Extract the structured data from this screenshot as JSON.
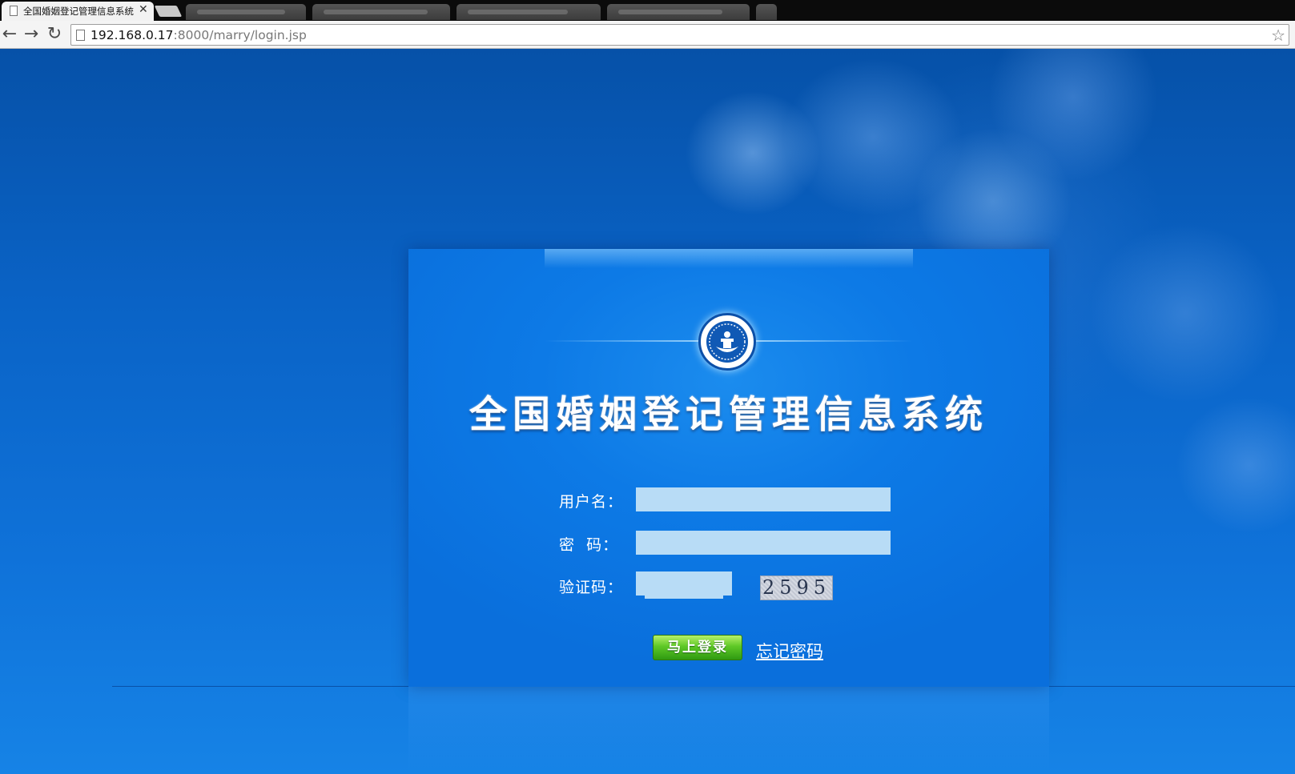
{
  "browser": {
    "active_tab_title": "全国婚姻登记管理信息系统",
    "url_host": "192.168.0.17",
    "url_path": ":8000/marry/login.jsp",
    "icons": {
      "back": "arrow-left-icon",
      "forward": "arrow-right-icon",
      "reload": "reload-icon",
      "bookmark": "star-icon",
      "tab_close": "close-icon"
    }
  },
  "login": {
    "system_title": "全国婚姻登记管理信息系统",
    "username_label": "用户名：",
    "password_label": "密  码：",
    "captcha_label": "验证码：",
    "username_value": "",
    "password_value": "",
    "captcha_value": "",
    "captcha_image_text": "2595",
    "submit_label": "马上登录",
    "forgot_password_label": "忘记密码"
  },
  "colors": {
    "page_bg": "#0a63c6",
    "panel_bg": "#0d7ae6",
    "input_bg": "#b8dcf6",
    "button_green": "#5ec826"
  }
}
